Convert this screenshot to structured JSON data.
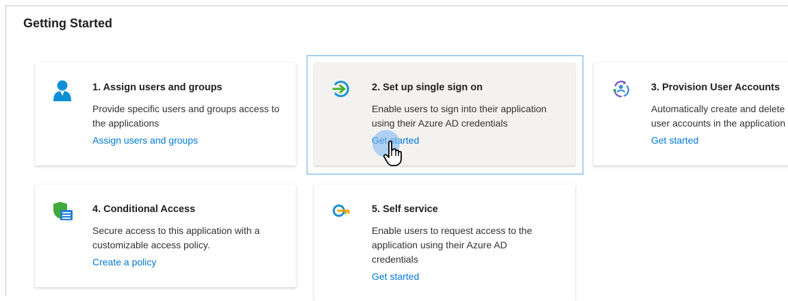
{
  "section_title": "Getting Started",
  "cards": [
    {
      "icon": "user-icon",
      "title": "1. Assign users and groups",
      "description": "Provide specific users and groups access to the applications",
      "link": "Assign users and groups"
    },
    {
      "icon": "sign-in-icon",
      "title": "2. Set up single sign on",
      "description": "Enable users to sign into their application using their Azure AD credentials",
      "link": "Get started"
    },
    {
      "icon": "provisioning-icon",
      "title": "3. Provision User Accounts",
      "description": "Automatically create and delete user accounts in the application",
      "link": "Get started"
    },
    {
      "icon": "shield-list-icon",
      "title": "4. Conditional Access",
      "description": "Secure access to this application with a customizable access policy.",
      "link": "Create a policy"
    },
    {
      "icon": "key-icon",
      "title": "5. Self service",
      "description": "Enable users to request access to the application using their Azure AD credentials",
      "link": "Get started"
    }
  ],
  "colors": {
    "link": "#0078d4",
    "hover_card_bg": "#f3f2f1",
    "highlight_border": "#5ea9e4"
  }
}
